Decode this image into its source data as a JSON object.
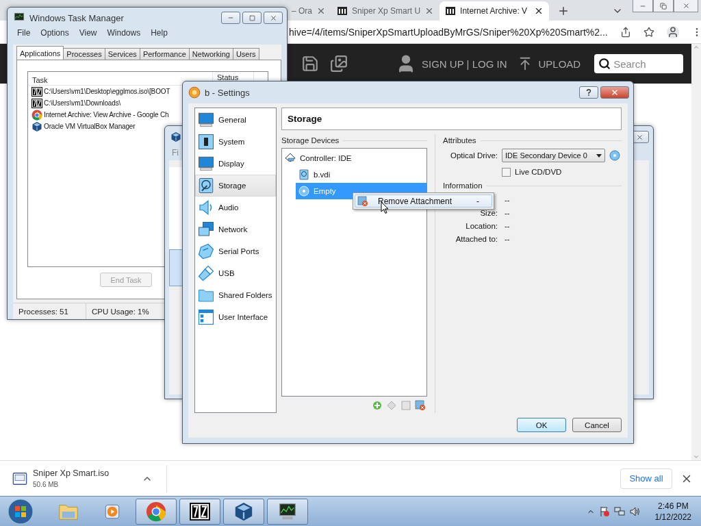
{
  "browser": {
    "tabs": [
      {
        "label": "– Ora",
        "selected": false
      },
      {
        "label": "Sniper Xp Smart U",
        "selected": false
      },
      {
        "label": "Internet Archive: V",
        "selected": true
      }
    ],
    "url": "hive=/4/items/SniperXpSmartUploadByMrGS/Sniper%20Xp%20Smart%2...",
    "header": {
      "account": "SIGN UP | LOG IN",
      "upload": "UPLOAD",
      "search_placeholder": "Search"
    }
  },
  "task_manager": {
    "title": "Windows Task Manager",
    "menu": [
      "File",
      "Options",
      "View",
      "Windows",
      "Help"
    ],
    "tabs": [
      {
        "label": "Applications",
        "selected": true
      },
      {
        "label": "Processes",
        "selected": false
      },
      {
        "label": "Services",
        "selected": false
      },
      {
        "label": "Performance",
        "selected": false
      },
      {
        "label": "Networking",
        "selected": false
      },
      {
        "label": "Users",
        "selected": false
      }
    ],
    "columns": [
      "Task",
      "Status"
    ],
    "rows": [
      {
        "kind": "archive",
        "task": "C:\\Users\\vm1\\Desktop\\egglmos.iso\\[BOOT"
      },
      {
        "kind": "archive",
        "task": "C:\\Users\\vm1\\Downloads\\"
      },
      {
        "kind": "browser",
        "task": "Internet Archive: View Archive - Google Ch"
      },
      {
        "kind": "vbox",
        "task": "Oracle VM VirtualBox Manager"
      }
    ],
    "end_task": {
      "label": "End Task",
      "disabled": true
    },
    "status": [
      "Processes: 51",
      "CPU Usage: 1%"
    ]
  },
  "vbox_manager": {
    "menu": "Fi"
  },
  "settings": {
    "title": "b - Settings",
    "categories": [
      {
        "label": "General",
        "kind": "monitor",
        "selected": false
      },
      {
        "label": "System",
        "kind": "chip",
        "selected": false
      },
      {
        "label": "Display",
        "kind": "monitor",
        "selected": false
      },
      {
        "label": "Storage",
        "kind": "disk",
        "selected": true
      },
      {
        "label": "Audio",
        "kind": "speaker",
        "selected": false
      },
      {
        "label": "Network",
        "kind": "network",
        "selected": false
      },
      {
        "label": "Serial Ports",
        "kind": "serial",
        "selected": false
      },
      {
        "label": "USB",
        "kind": "usb",
        "selected": false
      },
      {
        "label": "Shared Folders",
        "kind": "folder",
        "selected": false
      },
      {
        "label": "User Interface",
        "kind": "window",
        "selected": false
      }
    ],
    "page_title": "Storage",
    "storage_devices": {
      "title": "Storage Devices",
      "tree": [
        {
          "label": "Controller: IDE",
          "kind": "controller",
          "selected": false,
          "children": [
            {
              "label": "b.vdi",
              "kind": "disk",
              "selected": false
            },
            {
              "label": "Empty",
              "kind": "optical",
              "selected": true
            }
          ]
        }
      ]
    },
    "attributes": {
      "title": "Attributes",
      "optical_drive_label": "Optical Drive:",
      "optical_drive_value": "IDE Secondary Device 0",
      "live_cd": {
        "label": "Live CD/DVD",
        "checked": false
      }
    },
    "information": {
      "title": "Information",
      "rows": [
        {
          "value": "--"
        },
        {
          "label": "Size:",
          "value": "--"
        },
        {
          "label": "Location:",
          "value": "--"
        },
        {
          "label": "Attached to:",
          "value": "--"
        }
      ]
    },
    "buttons": [
      {
        "label": "OK",
        "default": true
      },
      {
        "label": "Cancel",
        "default": false
      }
    ]
  },
  "context_menu": {
    "items": [
      {
        "label": "Remove Attachment",
        "shortcut": "-"
      }
    ]
  },
  "download": {
    "filename": "Sniper Xp Smart.iso",
    "size": "50.6 MB",
    "show_all": "Show all"
  },
  "taskbar": {
    "apps": [
      {
        "kind": "explorer",
        "running": false
      },
      {
        "kind": "media",
        "running": false
      },
      {
        "kind": "chrome",
        "running": true
      },
      {
        "kind": "archive",
        "running": true
      },
      {
        "kind": "vbox",
        "running": true
      },
      {
        "kind": "taskmgr",
        "running": true
      }
    ],
    "time": "2:46 PM",
    "date": "1/12/2022"
  }
}
